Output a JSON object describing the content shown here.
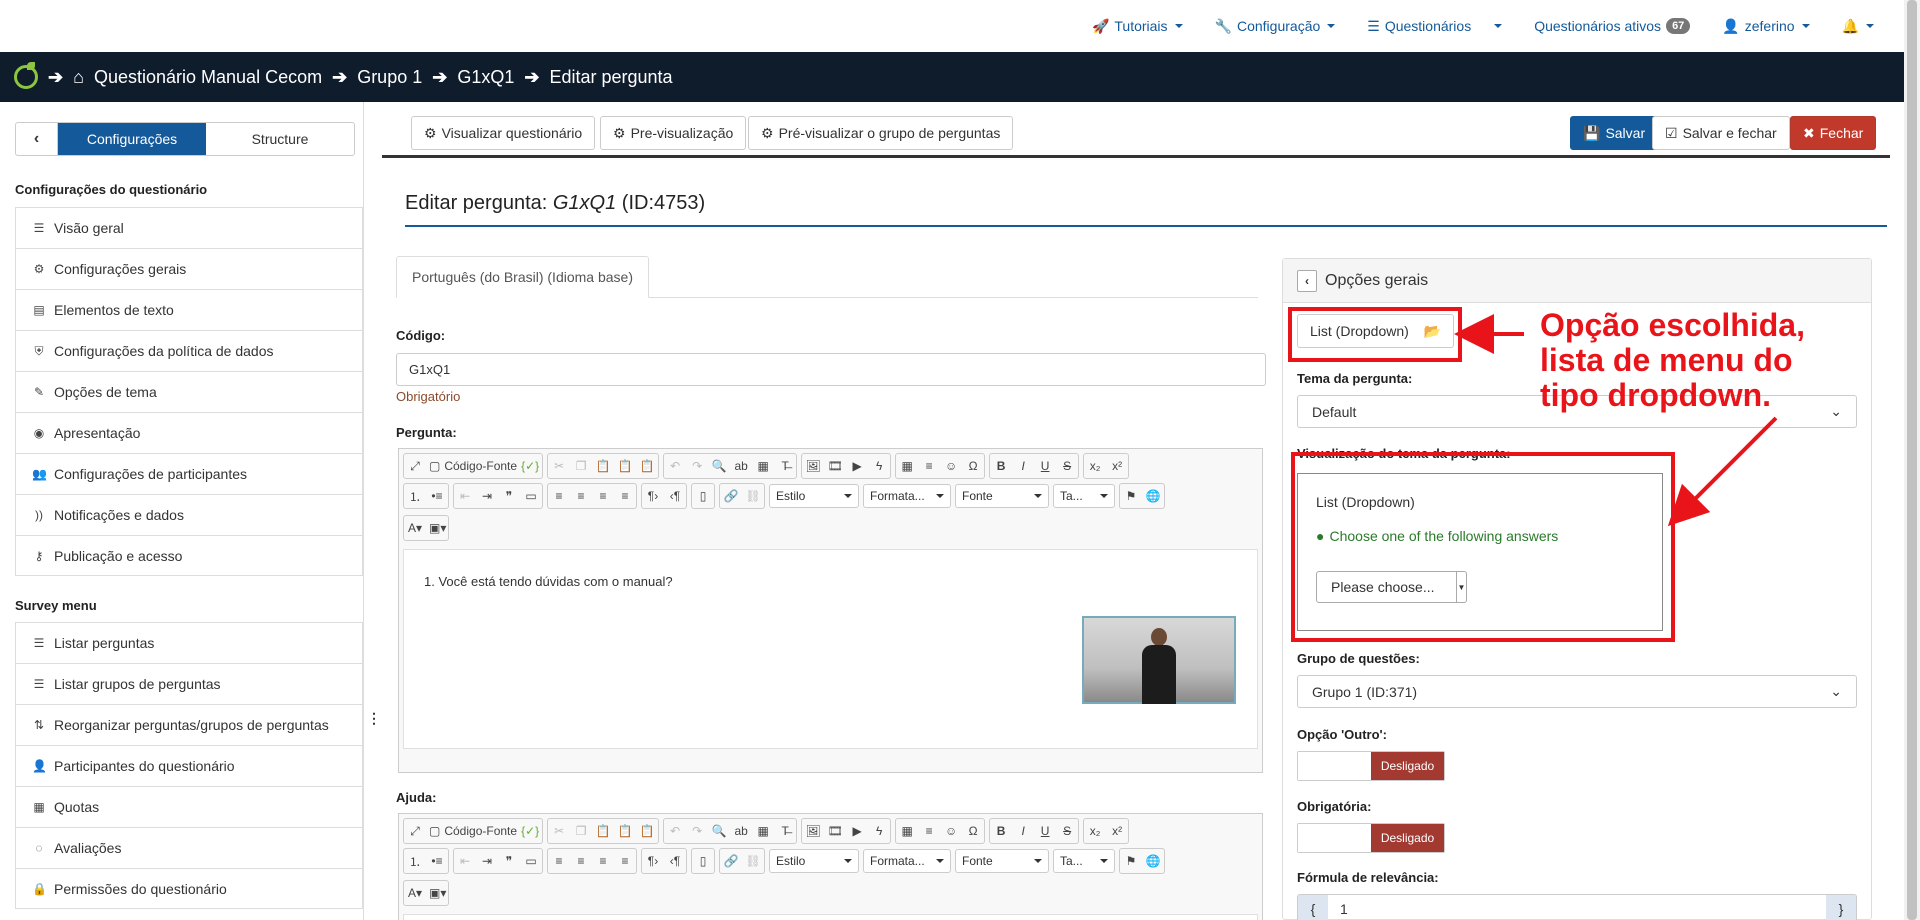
{
  "topnav": {
    "tutoriais": "Tutoriais",
    "configuracao": "Configuração",
    "questionarios": "Questionários",
    "ativos_label": "Questionários ativos",
    "ativos_count": "67",
    "user": "zeferino"
  },
  "breadcrumb": {
    "survey": "Questionário Manual Cecom",
    "group": "Grupo 1",
    "question": "G1xQ1",
    "current": "Editar pergunta"
  },
  "sidebar": {
    "tab_config": "Configurações",
    "tab_structure": "Structure",
    "section1": "Configurações do questionário",
    "items1": [
      {
        "label": "Visão geral",
        "icon": "list-icon"
      },
      {
        "label": "Configurações gerais",
        "icon": "gears-icon"
      },
      {
        "label": "Elementos de texto",
        "icon": "file-icon"
      },
      {
        "label": "Configurações da política de dados",
        "icon": "shield-icon"
      },
      {
        "label": "Opções de tema",
        "icon": "brush-icon"
      },
      {
        "label": "Apresentação",
        "icon": "eye-slash-icon"
      },
      {
        "label": "Configurações de participantes",
        "icon": "users-icon"
      },
      {
        "label": "Notificações e dados",
        "icon": "feed-icon"
      },
      {
        "label": "Publicação e acesso",
        "icon": "key-icon"
      }
    ],
    "section2": "Survey menu",
    "items2": [
      {
        "label": "Listar perguntas",
        "icon": "list-icon"
      },
      {
        "label": "Listar grupos de perguntas",
        "icon": "list-icon"
      },
      {
        "label": "Reorganizar perguntas/grupos de perguntas",
        "icon": "sort-icon"
      },
      {
        "label": "Participantes do questionário",
        "icon": "user-icon"
      },
      {
        "label": "Quotas",
        "icon": "tasks-icon"
      },
      {
        "label": "Avaliações",
        "icon": "comment-icon"
      },
      {
        "label": "Permissões do questionário",
        "icon": "lock-icon"
      }
    ]
  },
  "toolbar": {
    "view_survey": "Visualizar questionário",
    "preview": "Pre-visualização",
    "preview_group": "Pré-visualizar o grupo de perguntas",
    "save": "Salvar",
    "save_close": "Salvar e fechar",
    "close": "Fechar"
  },
  "main": {
    "title_prefix": "Editar pergunta: ",
    "title_code": "G1xQ1",
    "title_id": " (ID:4753)",
    "lang_tab": "Português (do Brasil) (Idioma base)",
    "code_label": "Código:",
    "code_value": "G1xQ1",
    "required_text": "Obrigatório",
    "question_label": "Pergunta:",
    "question_text": "1. Você está tendo dúvidas com o manual?",
    "help_label": "Ajuda:",
    "editor": {
      "source": "Código-Fonte",
      "style": "Estilo",
      "format": "Formata...",
      "font": "Fonte",
      "size": "Ta..."
    }
  },
  "panel": {
    "title": "Opções gerais",
    "type_button": "List (Dropdown)",
    "theme_label": "Tema da pergunta:",
    "theme_value": "Default",
    "preview_label": "Visualização do tema da pergunta:",
    "preview_title": "List (Dropdown)",
    "preview_hint": "Choose one of the following answers",
    "preview_select": "Please choose...",
    "group_label": "Grupo de questões:",
    "group_value": "Grupo 1 (ID:371)",
    "other_label": "Opção 'Outro':",
    "off_text": "Desligado",
    "mandatory_label": "Obrigatória:",
    "relevance_label": "Fórmula de relevância:",
    "relevance_value": "1",
    "relevance_left": "{",
    "relevance_right": "}"
  },
  "annotation": {
    "line1": "Opção escolhida,",
    "line2": "lista de menu do",
    "line3": "tipo dropdown."
  },
  "colors": {
    "brand": "#14599a",
    "navbar": "#0f1c2c",
    "annotation": "#e8141a",
    "off_toggle": "#a33a31"
  }
}
